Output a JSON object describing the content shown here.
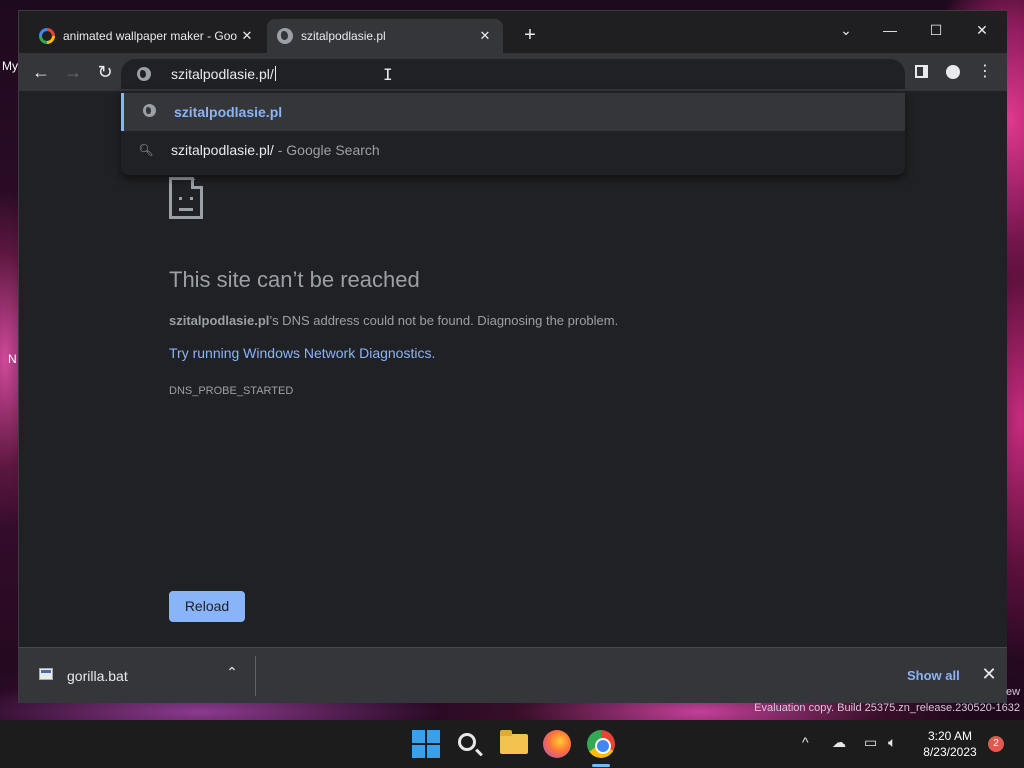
{
  "desktop": {
    "labels": [
      "My",
      "N"
    ],
    "watermark": "Evaluation copy. Build 25375.zn_release.230520-1632",
    "watermark_tail": "ew"
  },
  "browser": {
    "tabs": [
      {
        "title": "animated wallpaper maker - Goo",
        "active": false,
        "favicon": "google-icon"
      },
      {
        "title": "szitalpodlasie.pl",
        "active": true,
        "favicon": "globe-icon"
      }
    ],
    "new_tab_label": "+",
    "window_controls": {
      "menu": "⌄",
      "minimize": "—",
      "maximize": "☐",
      "close": "✕"
    },
    "toolbar": {
      "back": "←",
      "forward": "→",
      "reload": "↻"
    },
    "omnibox": {
      "value": "szitalpodlasie.pl/"
    },
    "suggestions": [
      {
        "text": "szitalpodlasie.pl",
        "sub": "",
        "icon": "globe-icon",
        "selected": true
      },
      {
        "text": "szitalpodlasie.pl/",
        "sub": "- Google Search",
        "icon": "search-icon",
        "selected": false
      }
    ],
    "right_icons": [
      "side-panel-icon",
      "profile-icon",
      "kebab-menu-icon"
    ]
  },
  "error_page": {
    "title": "This site can’t be reached",
    "domain": "szitalpodlasie.pl",
    "description_rest": "’s DNS address could not be found. Diagnosing the problem.",
    "link": "Try running Windows Network Diagnostics.",
    "code": "DNS_PROBE_STARTED",
    "reload_label": "Reload"
  },
  "download_shelf": {
    "file_name": "gorilla.bat",
    "show_all": "Show all",
    "close": "✕",
    "chevron": "^"
  },
  "taskbar": {
    "apps": [
      "start-icon",
      "search-icon",
      "file-explorer-icon",
      "firefox-icon",
      "chrome-icon"
    ],
    "time": "3:20 AM",
    "date": "8/23/2023",
    "notification_count": "2"
  },
  "colors": {
    "accent": "#8ab4f8",
    "page_bg": "#202124",
    "toolbar_bg": "#35363a"
  }
}
